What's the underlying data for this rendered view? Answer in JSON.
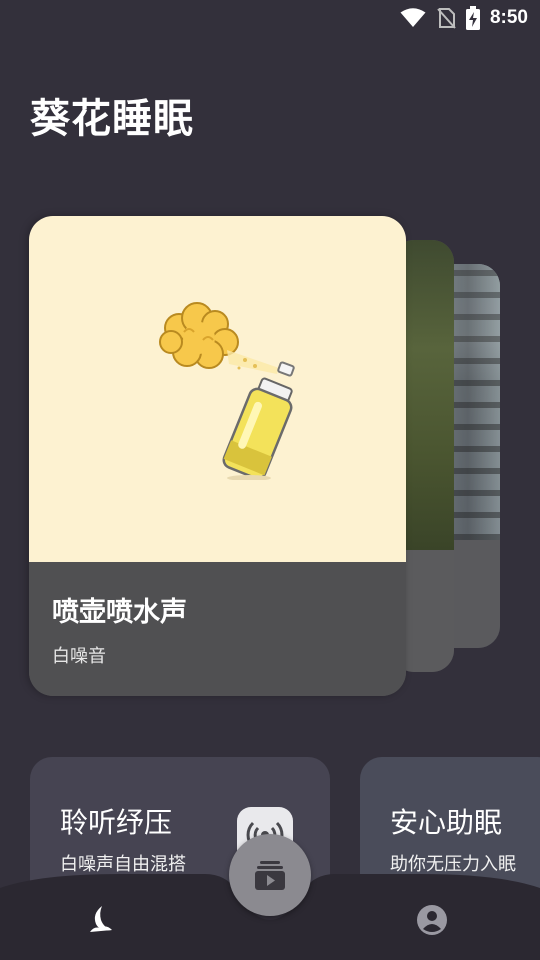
{
  "status_bar": {
    "time": "8:50",
    "icons": [
      "wifi-icon",
      "no-sim-icon",
      "battery-charging-icon"
    ]
  },
  "app": {
    "title": "葵花睡眠"
  },
  "featured_card": {
    "title": "喷壶喷水声",
    "subtitle": "白噪音",
    "illustration": "spray-can-icon",
    "art_background": "#fdf2d1"
  },
  "feature_cards": [
    {
      "title": "聆听纾压",
      "description": "白噪声自由混搭",
      "icon": "radio-broadcast-icon"
    },
    {
      "title": "安心助眠",
      "description": "助你无压力入眠"
    }
  ],
  "bottom_nav": {
    "items": [
      {
        "icon": "moon-icon",
        "active": true
      },
      {
        "icon": "player-icon",
        "center": true
      },
      {
        "icon": "user-icon",
        "active": false
      }
    ]
  },
  "colors": {
    "background": "#33303b",
    "card_bottom": "#505052",
    "fab": "#8b8a90"
  }
}
